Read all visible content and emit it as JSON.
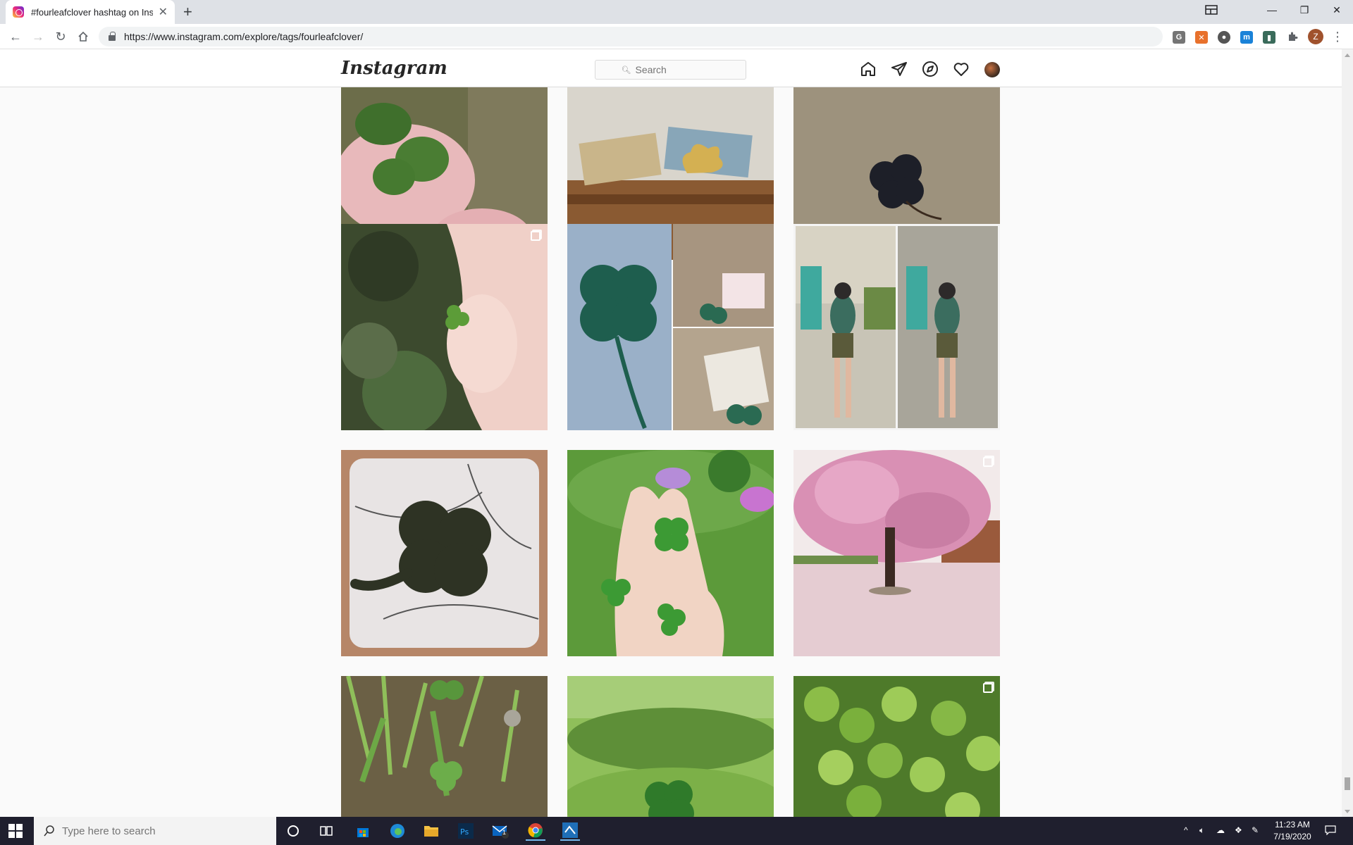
{
  "browser": {
    "tab_title": "#fourleafclover hashtag on Insta",
    "url": "https://www.instagram.com/explore/tags/fourleafclover/",
    "profile_initial": "Z",
    "extensions": [
      {
        "name": "g-ext-icon",
        "letter": "G",
        "color": "#757575"
      },
      {
        "name": "x-ext-icon",
        "letter": "✕",
        "color": "#e8712c"
      },
      {
        "name": "circle-ext-icon",
        "letter": "●",
        "color": "#555555"
      },
      {
        "name": "m-ext-icon",
        "letter": "m",
        "color": "#1a82d8"
      },
      {
        "name": "doc-ext-icon",
        "letter": "▮",
        "color": "#3a6b5b"
      }
    ]
  },
  "instagram": {
    "logo": "Instagram",
    "search_placeholder": "Search"
  },
  "posts": [
    {
      "row": 0,
      "col": 0,
      "scene": "hand-clover",
      "multi": false
    },
    {
      "row": 0,
      "col": 1,
      "scene": "suitcase",
      "multi": false
    },
    {
      "row": 0,
      "col": 2,
      "scene": "burlap-clover",
      "multi": false
    },
    {
      "row": 1,
      "col": 0,
      "scene": "fingers-tiny-clover",
      "multi": true
    },
    {
      "row": 1,
      "col": 1,
      "scene": "crochet-collage",
      "multi": false
    },
    {
      "row": 1,
      "col": 2,
      "scene": "mirror-selfies",
      "multi": false
    },
    {
      "row": 2,
      "col": 0,
      "scene": "marble-crochet",
      "multi": false
    },
    {
      "row": 2,
      "col": 1,
      "scene": "palm-clovers",
      "multi": false
    },
    {
      "row": 2,
      "col": 2,
      "scene": "pink-tree",
      "multi": true
    },
    {
      "row": 3,
      "col": 0,
      "scene": "grass-ground",
      "multi": false
    },
    {
      "row": 3,
      "col": 1,
      "scene": "park-clover",
      "multi": false
    },
    {
      "row": 3,
      "col": 2,
      "scene": "clover-patch",
      "multi": true
    }
  ],
  "taskbar": {
    "search_placeholder": "Type here to search",
    "time": "11:23 AM",
    "date": "7/19/2020",
    "mail_badge": "1"
  }
}
